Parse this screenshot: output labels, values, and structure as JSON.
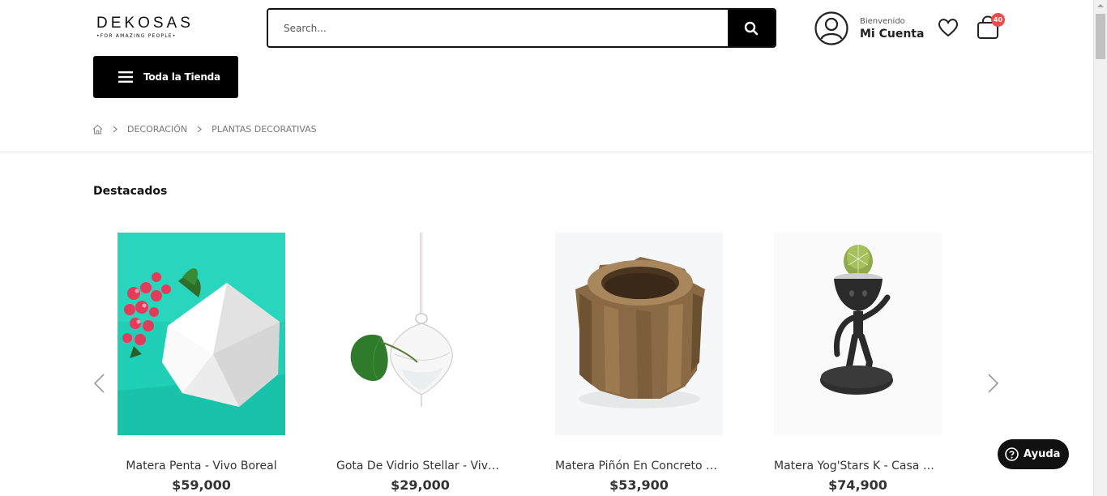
{
  "header": {
    "logo_main": "DEKOSAS",
    "logo_sub": "•FOR AMAZING PEOPLE•",
    "search_placeholder": "Search...",
    "welcome": "Bienvenido",
    "account_label": "Mi Cuenta",
    "cart_count": "40",
    "store_button": "Toda la Tienda"
  },
  "breadcrumb": {
    "items": [
      "DECORACIÓN",
      "PLANTAS DECORATIVAS"
    ]
  },
  "section": {
    "title": "Destacados"
  },
  "products": [
    {
      "name": "Matera Penta - Vivo Boreal",
      "price": "$59,000"
    },
    {
      "name": "Gota De Vidrio Stellar - Vivo Boreal",
      "price": "$29,000"
    },
    {
      "name": "Matera Piñón En Concreto Café",
      "price": "$53,900"
    },
    {
      "name": "Matera Yog'Stars K - Casa Rainbow",
      "price": "$74,900"
    }
  ],
  "help": {
    "label": "Ayuda"
  },
  "colors": {
    "accent": "#000000",
    "badge": "#ef4a4a",
    "product1_bg": "#1fd0b6"
  }
}
